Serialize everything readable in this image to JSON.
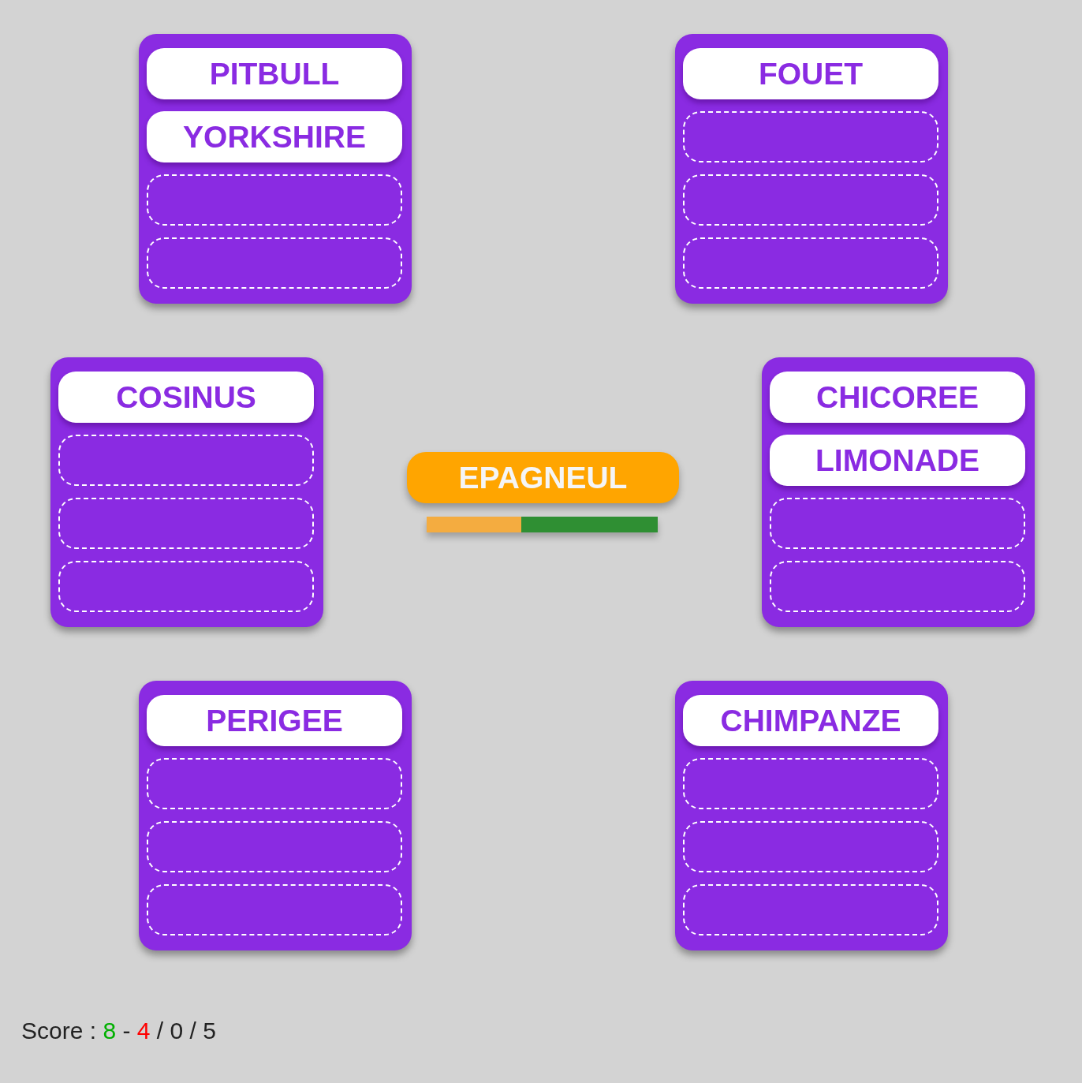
{
  "groups": [
    {
      "slots": [
        {
          "kind": "word",
          "text": "PITBULL"
        },
        {
          "kind": "word",
          "text": "YORKSHIRE"
        },
        {
          "kind": "empty"
        },
        {
          "kind": "empty"
        }
      ]
    },
    {
      "slots": [
        {
          "kind": "word",
          "text": "FOUET"
        },
        {
          "kind": "empty"
        },
        {
          "kind": "empty"
        },
        {
          "kind": "empty"
        }
      ]
    },
    {
      "slots": [
        {
          "kind": "word",
          "text": "COSINUS"
        },
        {
          "kind": "empty"
        },
        {
          "kind": "empty"
        },
        {
          "kind": "empty"
        }
      ]
    },
    {
      "slots": [
        {
          "kind": "word",
          "text": "CHICOREE"
        },
        {
          "kind": "word",
          "text": "LIMONADE"
        },
        {
          "kind": "empty"
        },
        {
          "kind": "empty"
        }
      ]
    },
    {
      "slots": [
        {
          "kind": "word",
          "text": "PERIGEE"
        },
        {
          "kind": "empty"
        },
        {
          "kind": "empty"
        },
        {
          "kind": "empty"
        }
      ]
    },
    {
      "slots": [
        {
          "kind": "word",
          "text": "CHIMPANZE"
        },
        {
          "kind": "empty"
        },
        {
          "kind": "empty"
        },
        {
          "kind": "empty"
        }
      ]
    }
  ],
  "current": {
    "word": "EPAGNEUL",
    "timer": {
      "level": 0.41
    }
  },
  "score": {
    "parts": [
      {
        "text": "Score :"
      },
      {
        "text": "8",
        "color": "#00b000"
      },
      {
        "text": "-"
      },
      {
        "text": "4",
        "color": "#ff0000"
      },
      {
        "text": "/ 0 / 5"
      }
    ]
  }
}
